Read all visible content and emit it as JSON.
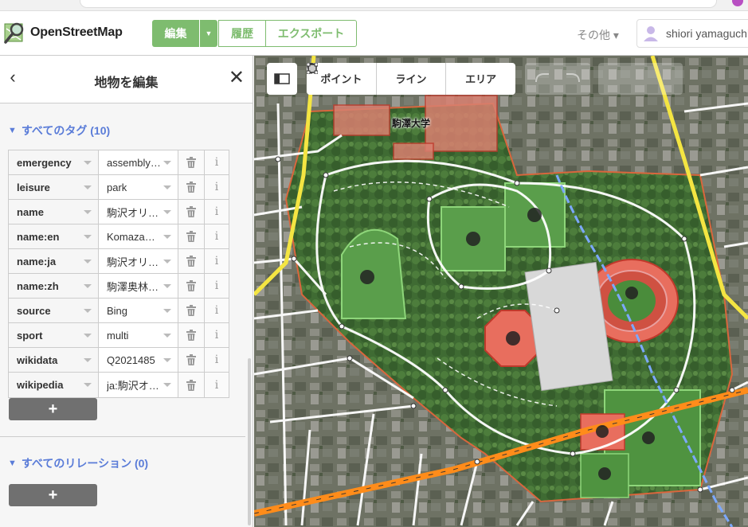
{
  "topbar": {
    "logo_text": "OpenStreetMap",
    "edit_label": "編集",
    "history_label": "履歴",
    "export_label": "エクスポート",
    "more_label": "その他 ▾",
    "user_name": "shiori yamaguchi"
  },
  "sidebar": {
    "title": "地物を編集",
    "tags_section": "すべてのタグ (10)",
    "relations_section": "すべてのリレーション (0)",
    "add_label": "+",
    "tags": [
      {
        "key": "emergency",
        "value": "assembly_…"
      },
      {
        "key": "leisure",
        "value": "park"
      },
      {
        "key": "name",
        "value": "駒沢オリ…"
      },
      {
        "key": "name:en",
        "value": "Komazaw…"
      },
      {
        "key": "name:ja",
        "value": "駒沢オリ…"
      },
      {
        "key": "name:zh",
        "value": "駒澤奥林…"
      },
      {
        "key": "source",
        "value": "Bing"
      },
      {
        "key": "sport",
        "value": "multi"
      },
      {
        "key": "wikidata",
        "value": "Q2021485"
      },
      {
        "key": "wikipedia",
        "value": "ja:駒沢オ…"
      }
    ]
  },
  "map": {
    "modes": [
      {
        "label": "ポイント",
        "icon": "point-icon"
      },
      {
        "label": "ライン",
        "icon": "line-icon"
      },
      {
        "label": "エリア",
        "icon": "area-icon"
      }
    ],
    "school_label": "駒澤大学"
  },
  "colors": {
    "brand_green": "#7ebc6f",
    "section_blue": "#5a7cd8",
    "rail_orange": "#ff8c1a",
    "road_yellow": "#f4e542"
  }
}
